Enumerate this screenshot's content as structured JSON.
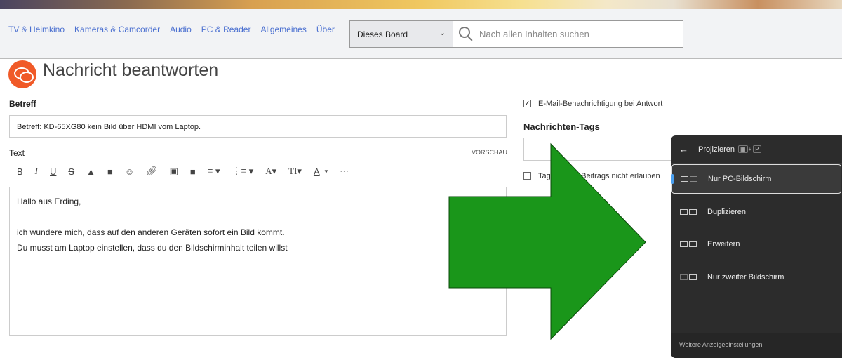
{
  "nav": {
    "links": [
      "TV & Heimkino",
      "Kameras & Camcorder",
      "Audio",
      "PC & Reader",
      "Allgemeines",
      "Über"
    ],
    "scope": "Dieses Board",
    "search_placeholder": "Nach allen Inhalten suchen"
  },
  "page": {
    "title": "Nachricht beantworten"
  },
  "form": {
    "subject_label": "Betreff",
    "subject_value": "Betreff: KD-65XG80 kein Bild über HDMI vom Laptop.",
    "text_label": "Text",
    "preview": "VORSCHAU",
    "body_lines": [
      "Hallo aus Erding,",
      "",
      "ich wundere mich, dass auf den anderen Geräten sofort ein Bild kommt.",
      "Du musst am Laptop einstellen, dass du den Bildschirminhalt teilen willst"
    ],
    "email_notify": "E-Mail-Benachrichtigung bei Antwort",
    "email_notify_checked": true,
    "tags_label": "Nachrichten-Tags",
    "tags_disable": "Tags dieses Beitrags nicht erlauben",
    "tags_disable_checked": false
  },
  "projection": {
    "title": "Projizieren",
    "shortcut_key": "P",
    "options": [
      "Nur PC-Bildschirm",
      "Duplizieren",
      "Erweitern",
      "Nur zweiter Bildschirm"
    ],
    "selected": "Nur PC-Bildschirm",
    "footer": "Weitere Anzeigeeinstellungen"
  },
  "colors": {
    "arrow": "#1a961a",
    "logo": "#f05a28",
    "link": "#4a6fd0"
  }
}
